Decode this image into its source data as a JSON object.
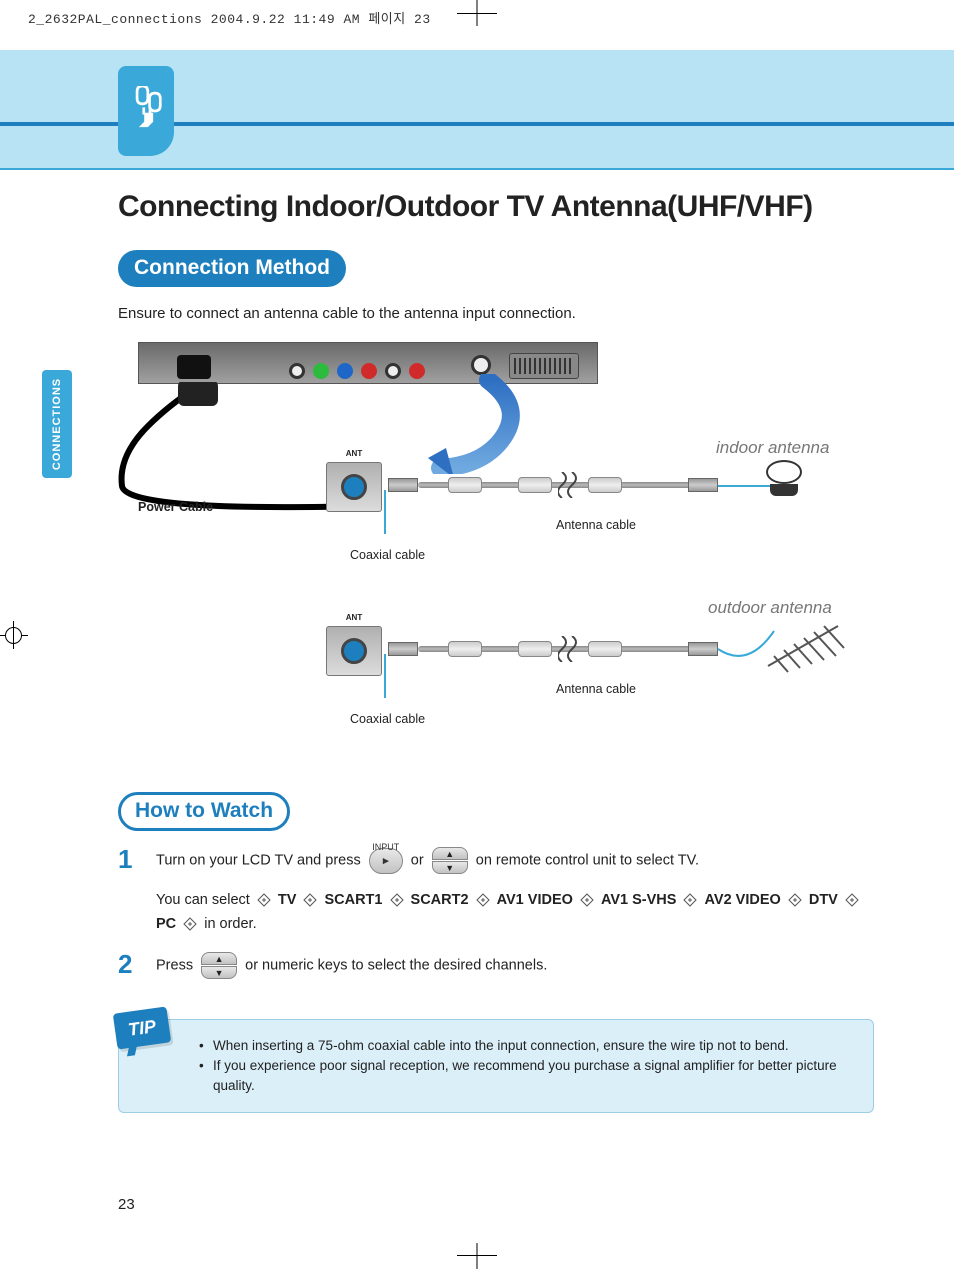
{
  "print_header": "2_2632PAL_connections  2004.9.22 11:49 AM  페이지 23",
  "side_tab": "CONNECTIONS",
  "page_title": "Connecting Indoor/Outdoor TV Antenna(UHF/VHF)",
  "section_connection_method": "Connection Method",
  "intro": "Ensure to connect an antenna cable to the antenna input connection.",
  "labels": {
    "power_cable": "Power Cable",
    "coaxial_cable": "Coaxial cable",
    "antenna_cable": "Antenna cable",
    "indoor_antenna": "indoor antenna",
    "outdoor_antenna": "outdoor antenna",
    "ant_port": "ANT"
  },
  "section_how_to_watch": "How to Watch",
  "steps": {
    "s1_a": "Turn on your LCD TV and press",
    "s1_or": "or",
    "s1_b": "on remote control unit to select TV.",
    "s1_select_prefix": "You can select",
    "s1_select_suffix": "in order.",
    "s2_a": "Press",
    "s2_b": "or numeric keys to select the desired channels."
  },
  "input_label": "INPUT",
  "input_cycle": [
    "TV",
    "SCART1",
    "SCART2",
    "AV1 VIDEO",
    "AV1 S-VHS",
    "AV2 VIDEO",
    "DTV",
    "PC"
  ],
  "tip_label": "TIP",
  "tips": [
    "When inserting a 75-ohm coaxial cable into the input connection, ensure the wire tip not to bend.",
    "If you experience poor signal reception, we recommend you purchase a signal amplifier for better picture quality."
  ],
  "page_number": "23"
}
